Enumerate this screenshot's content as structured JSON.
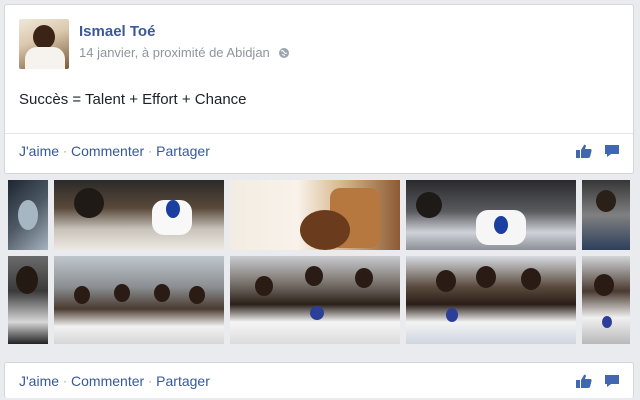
{
  "post": {
    "author": "Ismael Toé",
    "timestamp": "14 janvier, à proximité de Abidjan",
    "privacy_icon": "globe-icon",
    "text": "Succès = Talent + Effort + Chance",
    "actions": {
      "like": "J'aime",
      "separator": "·",
      "comment": "Commenter",
      "share": "Partager"
    }
  },
  "photos": {
    "count_visible": 10
  },
  "footer": {
    "actions": {
      "like": "J'aime",
      "separator": "·",
      "comment": "Commenter",
      "share": "Partager"
    }
  },
  "colors": {
    "link": "#365899",
    "author": "#3b5998",
    "meta": "#90949c",
    "background": "#e9ebee"
  }
}
